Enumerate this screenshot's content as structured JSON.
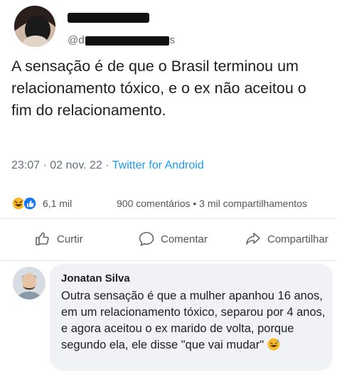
{
  "tweet": {
    "handle_prefix": "@d",
    "handle_suffix": "s",
    "text": "A sensação é de que o Brasil terminou um relacionamento tóxico, e o ex não aceitou o fim do relacionamento.",
    "time": "23:07",
    "dot1": "·",
    "date": "02 nov. 22",
    "dot2": "·",
    "source": "Twitter for Android"
  },
  "stats": {
    "reactions_count": "6,1 mil",
    "comments_shares": "900 comentários • 3 mil compartilhamentos"
  },
  "actions": {
    "like": "Curtir",
    "comment": "Comentar",
    "share": "Compartilhar"
  },
  "comment": {
    "author": "Jonatan Silva",
    "text": "Outra sensação é que a mulher apanhou 16 anos, em um relacionamento tóxico, separou por 4 anos, e agora aceitou o ex marido de volta, porque segundo ela, ele disse \"que vai mudar\""
  },
  "colors": {
    "source_link": "#1d9bf0",
    "meta_text": "#62707a",
    "bubble_bg": "#f0f2f5"
  },
  "icons": [
    "haha-reaction-icon",
    "like-reaction-icon",
    "thumb-up-icon",
    "speech-bubble-icon",
    "share-arrow-icon",
    "grinning-sweat-emoji"
  ]
}
